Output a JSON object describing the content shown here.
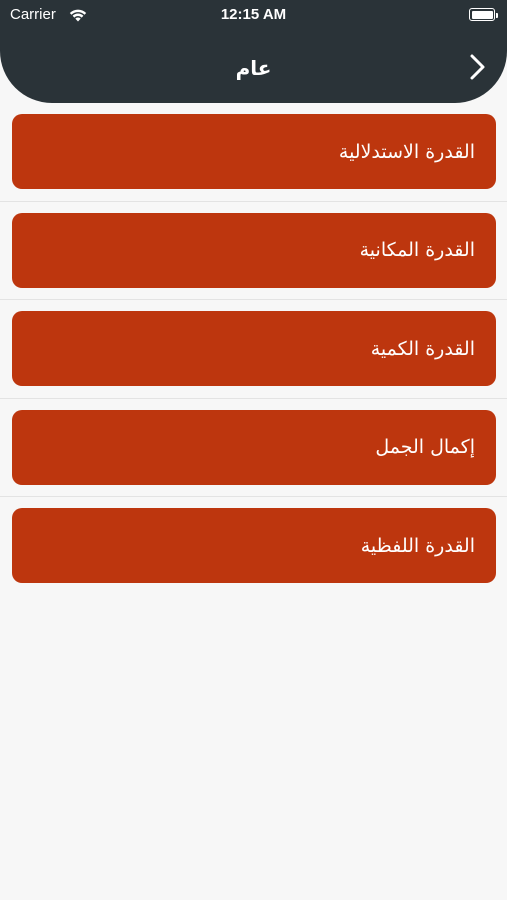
{
  "status_bar": {
    "carrier": "Carrier",
    "time": "12:15 AM",
    "wifi_icon": "wifi-icon",
    "battery_icon": "battery-icon"
  },
  "nav": {
    "title": "عام",
    "back_icon": "chevron-right-icon"
  },
  "items": [
    {
      "label": "القدرة الاستدلالية"
    },
    {
      "label": "القدرة المكانية"
    },
    {
      "label": "القدرة الكمية"
    },
    {
      "label": "إكمال الجمل"
    },
    {
      "label": "القدرة اللفظية"
    }
  ],
  "colors": {
    "header_bg": "#2a3338",
    "card_bg": "#bd360e",
    "page_bg": "#f7f7f7"
  }
}
